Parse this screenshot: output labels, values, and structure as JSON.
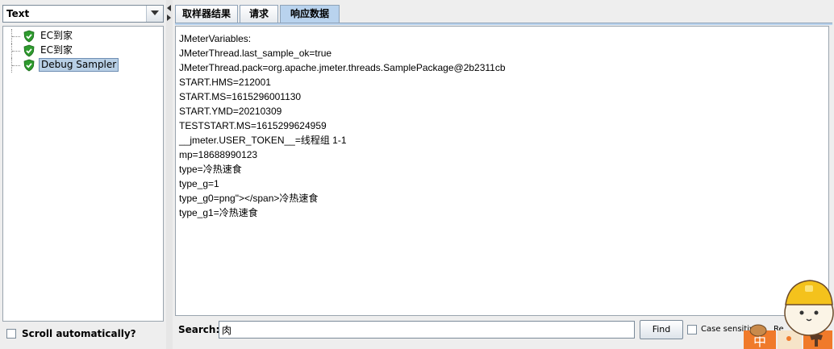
{
  "renderer": {
    "selected": "Text"
  },
  "tree": {
    "items": [
      {
        "label": "EC到家",
        "status": "success"
      },
      {
        "label": "EC到家",
        "status": "success"
      },
      {
        "label": "Debug Sampler",
        "status": "success",
        "selected": true
      }
    ]
  },
  "scroll_automatically": {
    "label": "Scroll automatically?",
    "checked": false
  },
  "tabs": [
    {
      "label": "取样器结果"
    },
    {
      "label": "请求"
    },
    {
      "label": "响应数据",
      "active": true
    }
  ],
  "response_lines": [
    "JMeterVariables:",
    "JMeterThread.last_sample_ok=true",
    "JMeterThread.pack=org.apache.jmeter.threads.SamplePackage@2b2311cb",
    "START.HMS=212001",
    "START.MS=1615296001130",
    "START.YMD=20210309",
    "TESTSTART.MS=1615299624959",
    "__jmeter.USER_TOKEN__=线程组 1-1",
    "mp=18688990123",
    "type=冷热速食",
    "type_g=1",
    "type_g0=png\"></span>冷热速食",
    "type_g1=冷热速食"
  ],
  "search": {
    "label": "Search:",
    "value": "肉",
    "find_label": "Find",
    "case_label": "Case sensitive",
    "regex_label": "Re"
  },
  "mascot": {
    "text": "中"
  },
  "colors": {
    "accent": "#b9d3ee",
    "success": "#2e9a2e",
    "selection": "#b8cfe5"
  }
}
